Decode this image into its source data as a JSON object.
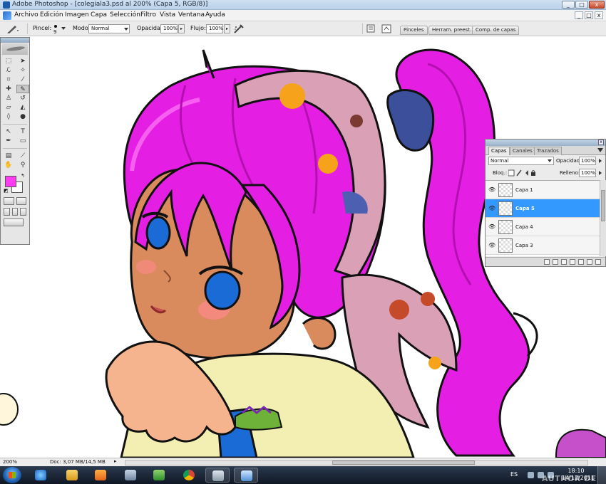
{
  "window": {
    "title": "Adobe Photoshop - [colegiala3.psd al 200% (Capa 5, RGB/8)]",
    "min_glyph": "_",
    "max_glyph": "□",
    "close_glyph": "x"
  },
  "menu": {
    "items": [
      "Archivo",
      "Edición",
      "Imagen",
      "Capa",
      "Selección",
      "Filtro",
      "Vista",
      "Ventana",
      "Ayuda"
    ],
    "mdi": [
      "_",
      "□",
      "x"
    ]
  },
  "options": {
    "brush_label": "Pincel:",
    "brush_size": "9",
    "mode_label": "Modo:",
    "mode_value": "Normal",
    "opacity_label": "Opacidad:",
    "opacity_value": "100%",
    "flow_label": "Flujo:",
    "flow_value": "100%"
  },
  "dock_tabs": [
    "Pinceles",
    "Herram. preest.",
    "Comp. de capas"
  ],
  "toolbox": {
    "foreground_color": "#ff3cf0",
    "background_color": "#ffffff"
  },
  "layers_panel": {
    "tabs": [
      "Capas",
      "Canales",
      "Trazados"
    ],
    "blend_mode": "Normal",
    "opacity_label": "Opacidad:",
    "opacity_value": "100%",
    "lock_label": "Bloq.:",
    "fill_label": "Relleno:",
    "fill_value": "100%",
    "layers": [
      {
        "name": "Capa 1",
        "selected": false
      },
      {
        "name": "Capa 5",
        "selected": true
      },
      {
        "name": "Capa 4",
        "selected": false
      },
      {
        "name": "Capa 3",
        "selected": false
      }
    ]
  },
  "status": {
    "zoom": "200%",
    "doc": "Doc: 3,07 MB/14,5 MB"
  },
  "taskbar": {
    "language": "ES",
    "time": "18:10",
    "date": "14/12/2011",
    "watermark": "AUTHOR DE"
  },
  "colors": {
    "hair": "#e51ee3",
    "skin": "#d98b5e",
    "eyes": "#1a6bd6",
    "shirt": "#f3efb3",
    "selected_layer": "#3399ff"
  }
}
